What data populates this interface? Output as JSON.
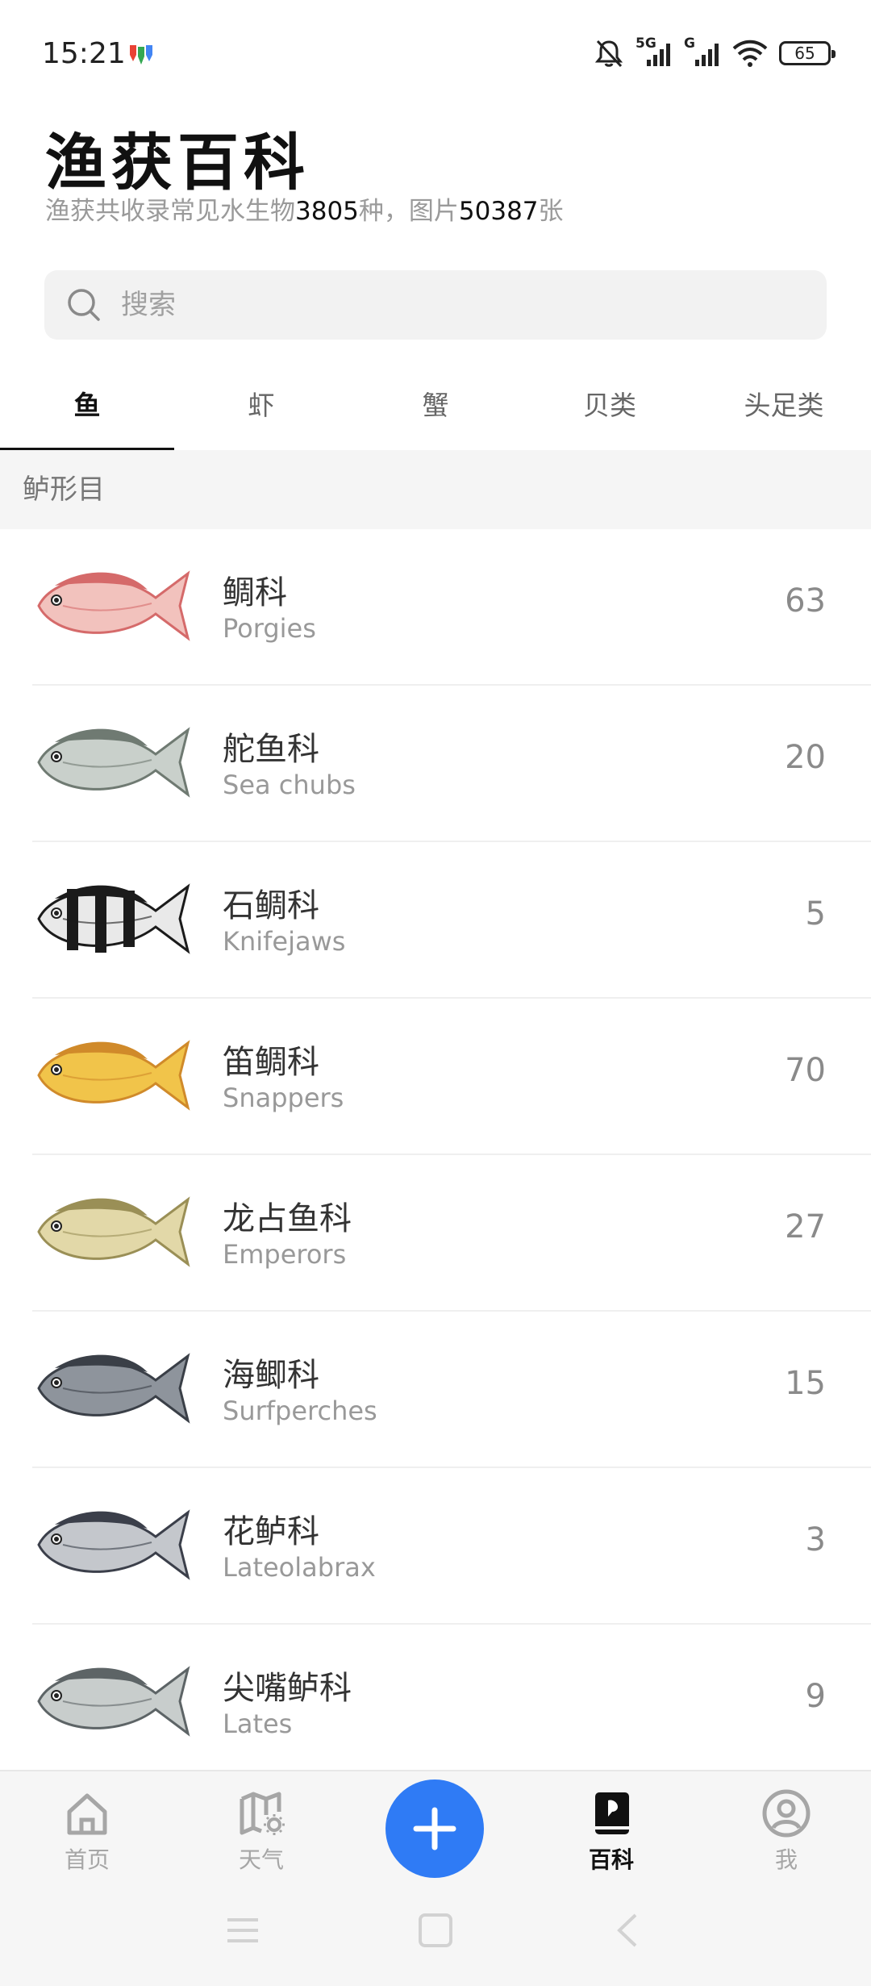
{
  "status_bar": {
    "time": "15:21",
    "network_1": "5G",
    "network_2": "G",
    "battery": "65"
  },
  "header": {
    "title": "渔获百科",
    "subtitle_prefix": "渔获共收录常见水生物",
    "species_count": "3805",
    "subtitle_mid": "种，图片",
    "image_count": "50387",
    "subtitle_suffix": "张"
  },
  "search": {
    "placeholder": "搜索"
  },
  "tabs": [
    {
      "label": "鱼",
      "active": true
    },
    {
      "label": "虾",
      "active": false
    },
    {
      "label": "蟹",
      "active": false
    },
    {
      "label": "贝类",
      "active": false
    },
    {
      "label": "头足类",
      "active": false
    }
  ],
  "section": {
    "label": "鲈形目"
  },
  "families": [
    {
      "name": "鲷科",
      "latin": "Porgies",
      "count": "63",
      "fish_colors": [
        "#d56a6a",
        "#f2c2bd"
      ]
    },
    {
      "name": "舵鱼科",
      "latin": "Sea chubs",
      "count": "20",
      "fish_colors": [
        "#6f7a72",
        "#c9d0cb"
      ]
    },
    {
      "name": "石鲷科",
      "latin": "Knifejaws",
      "count": "5",
      "fish_colors": [
        "#1b1b1b",
        "#e9e9e9"
      ]
    },
    {
      "name": "笛鲷科",
      "latin": "Snappers",
      "count": "70",
      "fish_colors": [
        "#d08a2a",
        "#f1c44a"
      ]
    },
    {
      "name": "龙占鱼科",
      "latin": "Emperors",
      "count": "27",
      "fish_colors": [
        "#9a8f56",
        "#e2d8a8"
      ]
    },
    {
      "name": "海鲫科",
      "latin": "Surfperches",
      "count": "15",
      "fish_colors": [
        "#3a3f47",
        "#8e949c"
      ]
    },
    {
      "name": "花鲈科",
      "latin": "Lateolabrax",
      "count": "3",
      "fish_colors": [
        "#3b3f4a",
        "#c4c7cc"
      ]
    },
    {
      "name": "尖嘴鲈科",
      "latin": "Lates",
      "count": "9",
      "fish_colors": [
        "#5d6466",
        "#c8cdcc"
      ]
    }
  ],
  "bottom_nav": [
    {
      "label": "首页",
      "icon": "home-icon"
    },
    {
      "label": "天气",
      "icon": "weather-map-icon"
    },
    {
      "label": "",
      "icon": "plus-icon"
    },
    {
      "label": "百科",
      "icon": "encyclopedia-book-icon",
      "active": true
    },
    {
      "label": "我",
      "icon": "profile-icon"
    }
  ],
  "colors": {
    "accent": "#2f7bf5",
    "text_primary": "#111111",
    "text_secondary": "#999999"
  }
}
